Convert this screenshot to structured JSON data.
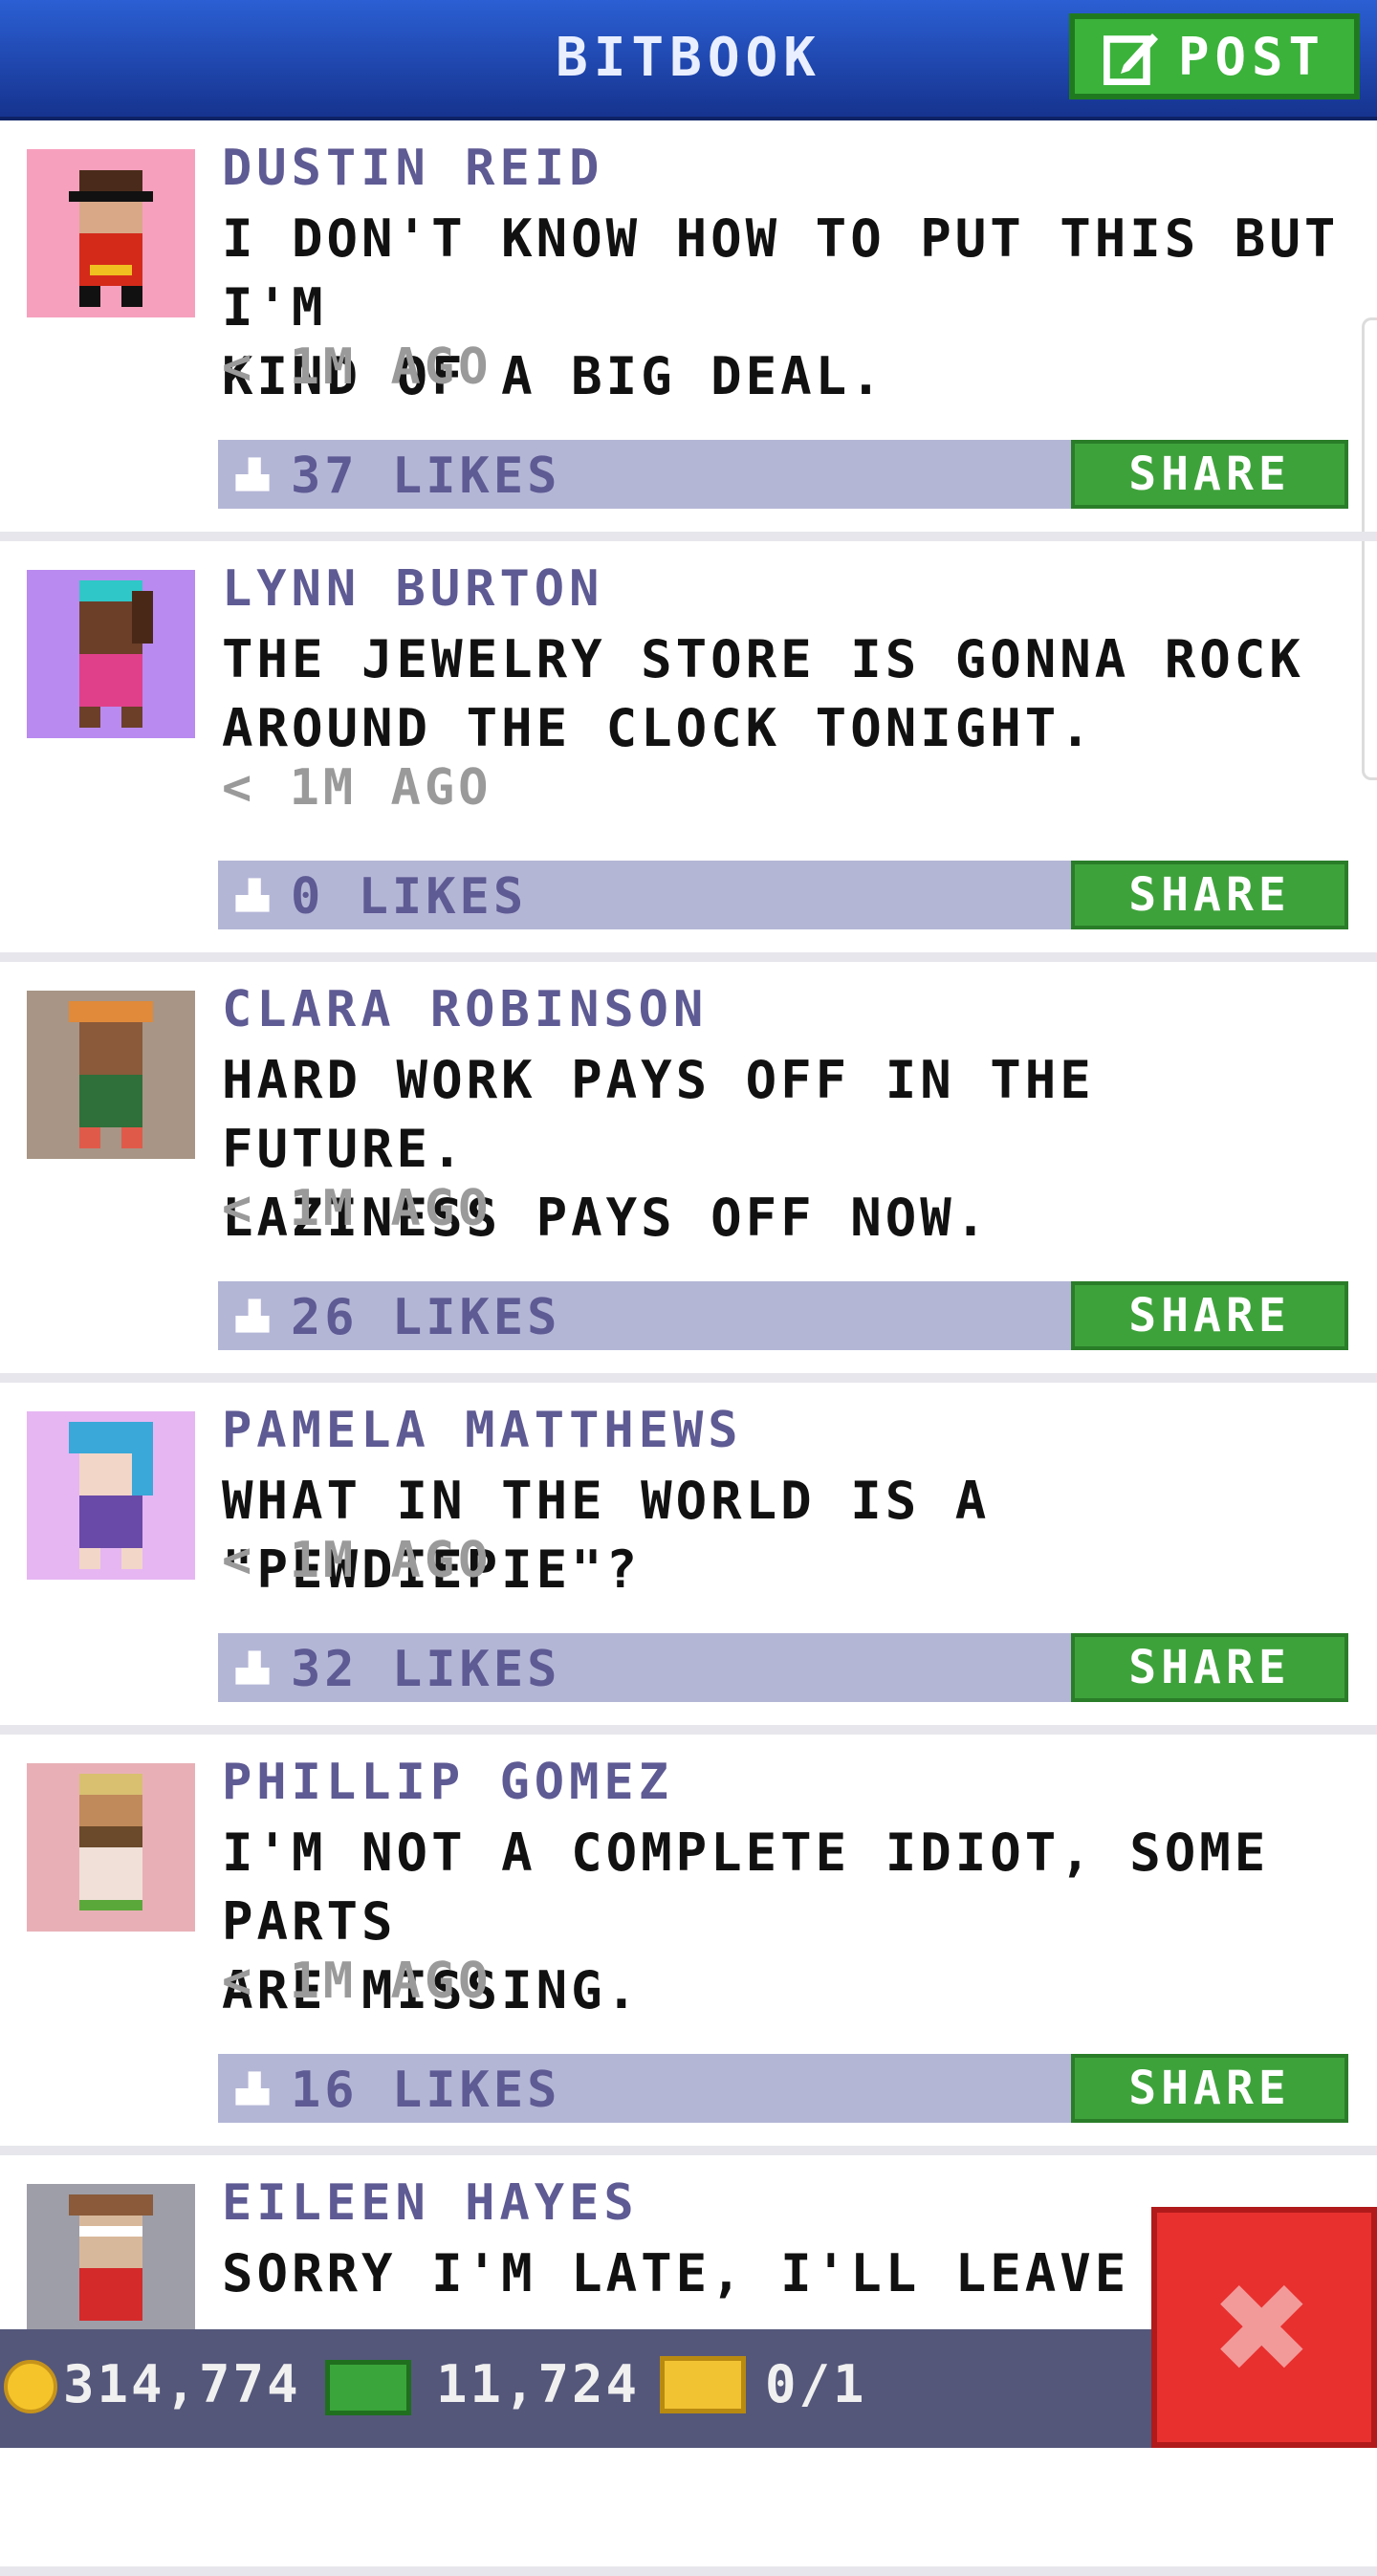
{
  "header": {
    "title": "BITBOOK",
    "post_label": "POST"
  },
  "posts": [
    {
      "name": "DUSTIN REID",
      "text": "I DON'T KNOW HOW TO PUT THIS BUT I'M\nKIND OF A BIG DEAL.",
      "time": "< 1M AGO",
      "likes": "37 LIKES",
      "share": "SHARE",
      "avatar_bg": "#f7a0bd"
    },
    {
      "name": "LYNN BURTON",
      "text": "THE JEWELRY STORE IS GONNA ROCK\nAROUND THE CLOCK TONIGHT.",
      "time": "< 1M AGO",
      "likes": "0 LIKES",
      "share": "SHARE",
      "avatar_bg": "#b98af0"
    },
    {
      "name": "CLARA ROBINSON",
      "text": "HARD WORK PAYS OFF IN THE FUTURE.\nLAZINESS PAYS OFF NOW.",
      "time": "< 1M AGO",
      "likes": "26 LIKES",
      "share": "SHARE",
      "avatar_bg": "#a89585"
    },
    {
      "name": "PAMELA MATTHEWS",
      "text": "WHAT IN THE WORLD IS A \"PEWDIEPIE\"?",
      "time": "< 1M AGO",
      "likes": "32 LIKES",
      "share": "SHARE",
      "avatar_bg": "#e6b6f2"
    },
    {
      "name": "PHILLIP GOMEZ",
      "text": "I'M NOT A COMPLETE IDIOT, SOME PARTS\nARE MISSING.",
      "time": "< 1M AGO",
      "likes": "16 LIKES",
      "share": "SHARE",
      "avatar_bg": "#e8b0b6"
    },
    {
      "name": "EILEEN HAYES",
      "text": "SORRY I'M LATE, I'LL LEAVE EARL",
      "avatar_bg": "#9e9ea8"
    }
  ],
  "status": {
    "coins": "314,774",
    "cash": "11,724",
    "tickets": "0/1"
  },
  "colors": {
    "header": "#2b5fd3",
    "post_button": "#3bb23a",
    "share_button": "#3ea23b",
    "likes_bar": "#b4b6d6",
    "name": "#5e5a93",
    "close": "#e8302f"
  },
  "icons": {
    "post": "edit-icon",
    "like": "thumb-up-icon",
    "coin": "coin-icon",
    "cash": "cash-icon",
    "ticket": "ticket-icon",
    "close": "close-icon"
  }
}
